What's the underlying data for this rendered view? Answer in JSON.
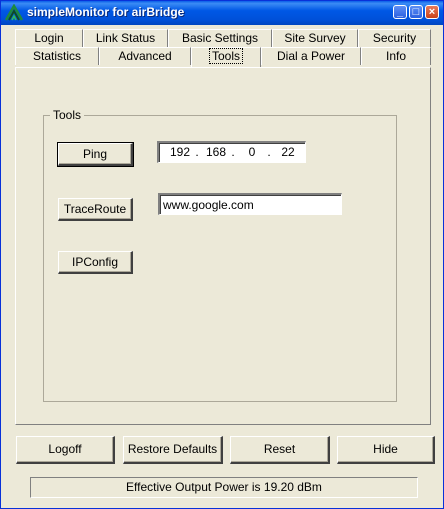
{
  "window": {
    "title": "simpleMonitor for airBridge",
    "controls": [
      "minimize-icon",
      "maximize-icon",
      "close-icon"
    ]
  },
  "tabs": {
    "row_top": [
      "Login",
      "Link Status",
      "Basic Settings",
      "Site Survey",
      "Security"
    ],
    "row_bottom": [
      "Statistics",
      "Advanced",
      "Tools",
      "Dial a Power",
      "Info"
    ],
    "selected": "Tools"
  },
  "tools": {
    "group_label": "Tools",
    "ping_label": "Ping",
    "traceroute_label": "TraceRoute",
    "ipconfig_label": "IPConfig",
    "ip": [
      "192",
      "168",
      "0",
      "22"
    ],
    "ip_separator": ".",
    "host_value": "www.google.com"
  },
  "footer": {
    "logoff_label": "Logoff",
    "restore_label": "Restore Defaults",
    "reset_label": "Reset",
    "hide_label": "Hide",
    "status_text": "Effective Output Power is 19.20 dBm"
  }
}
